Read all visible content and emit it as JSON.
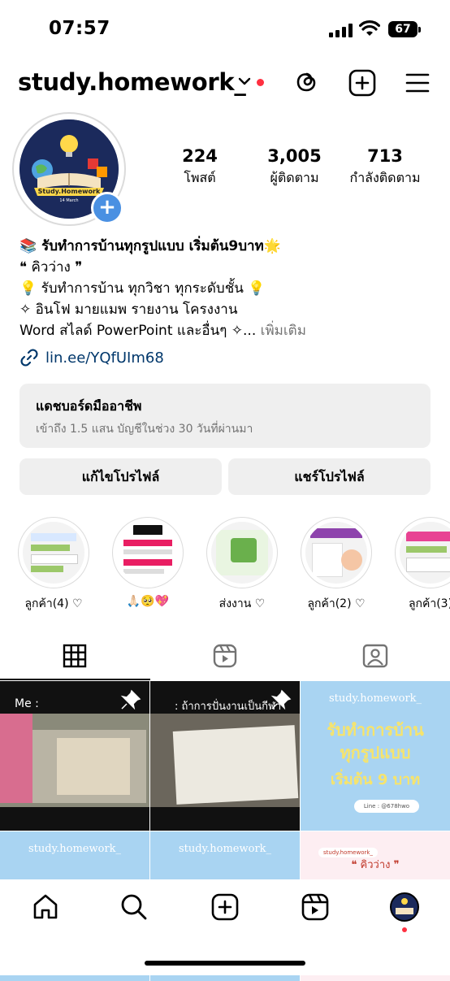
{
  "status": {
    "time": "07:57",
    "battery": "67"
  },
  "header": {
    "username": "study.homework_"
  },
  "profile": {
    "avatar_text": "Study.Homework",
    "avatar_date": "14 March",
    "stats": [
      {
        "value": "224",
        "label": "โพสต์"
      },
      {
        "value": "3,005",
        "label": "ผู้ติดตาม"
      },
      {
        "value": "713",
        "label": "กำลังติดตาม"
      }
    ],
    "bio": {
      "line1": "📚 รับทำการบ้านทุกรูปแบบ เริ่มต้น9บาท🌟",
      "line2": "❝ คิวว่าง ❞",
      "line3": "💡 รับทำการบ้าน ทุกวิชา ทุกระดับชั้น 💡",
      "line4": "✧ อินโฟ มายแมพ รายงาน โครงงาน",
      "line5": "Word สไลด์ PowerPoint และอื่นๆ ✧...",
      "more": "เพิ่มเติม"
    },
    "link": "lin.ee/YQfUIm68"
  },
  "dashboard": {
    "title": "แดชบอร์ดมืออาชีพ",
    "subtitle": "เข้าถึง 1.5 แสน บัญชีในช่วง 30 วันที่ผ่านมา"
  },
  "buttons": {
    "edit": "แก้ไขโปรไฟล์",
    "share": "แชร์โปรไฟล์"
  },
  "highlights": [
    {
      "label": "ลูกค้า(4) ♡"
    },
    {
      "label": "🙏🏻🥺💖"
    },
    {
      "label": "ส่งงาน ♡"
    },
    {
      "label": "ลูกค้า(2) ♡"
    },
    {
      "label": "ลูกค้า(3)"
    }
  ],
  "grid": {
    "post1_caption": "Me :",
    "post2_caption": ": ถ้าการปั่นงานเป็นกีฬา",
    "post3_brand": "study.homework_",
    "post3_title1": "รับทำการบ้าน",
    "post3_title2": "ทุกรูปแบบ",
    "post3_title3": "เริ่มต้น 9 บาท",
    "post3_line": "Line : @678hwo",
    "post4_brand": "study.homework_",
    "post5_brand": "study.homework_",
    "post6_brand": "study.homework_",
    "post6_tag": "❝ คิวว่าง ❞"
  },
  "colors": {
    "link": "#00376b",
    "badge": "#ff3040",
    "add_button": "#4a90e2",
    "sky": "#a9d4f2"
  }
}
